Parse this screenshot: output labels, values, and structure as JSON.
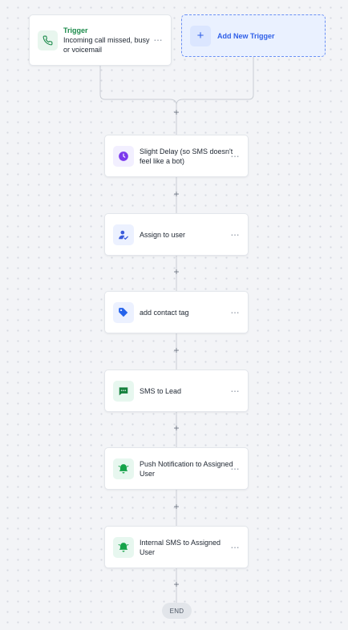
{
  "trigger": {
    "title": "Trigger",
    "description": "Incoming call missed, busy or voicemail",
    "icon": "phone-icon",
    "more": "⋯"
  },
  "add_trigger": {
    "label": "Add New Trigger",
    "plus": "+"
  },
  "add_step_symbol": "+",
  "actions": [
    {
      "label": "Slight Delay (so SMS doesn't feel like a bot)",
      "icon": "clock-icon",
      "more": "⋯"
    },
    {
      "label": "Assign to user",
      "icon": "user-assign-icon",
      "more": "⋯"
    },
    {
      "label": "add contact tag",
      "icon": "tag-icon",
      "more": "⋯"
    },
    {
      "label": "SMS to Lead",
      "icon": "chat-icon",
      "more": "⋯"
    },
    {
      "label": "Push Notification to Assigned User",
      "icon": "bell-icon",
      "more": "⋯"
    },
    {
      "label": "Internal SMS to Assigned User",
      "icon": "bell-icon",
      "more": "⋯"
    }
  ],
  "end_label": "END",
  "colors": {
    "trigger_green": "#1a8a4a",
    "add_trigger_blue": "#2f5fe8",
    "delay_purple": "#7c3aed",
    "assign_blue": "#3b5bdb",
    "tag_blue": "#2563eb",
    "sms_green": "#15803d",
    "bell_green": "#16a34a"
  }
}
